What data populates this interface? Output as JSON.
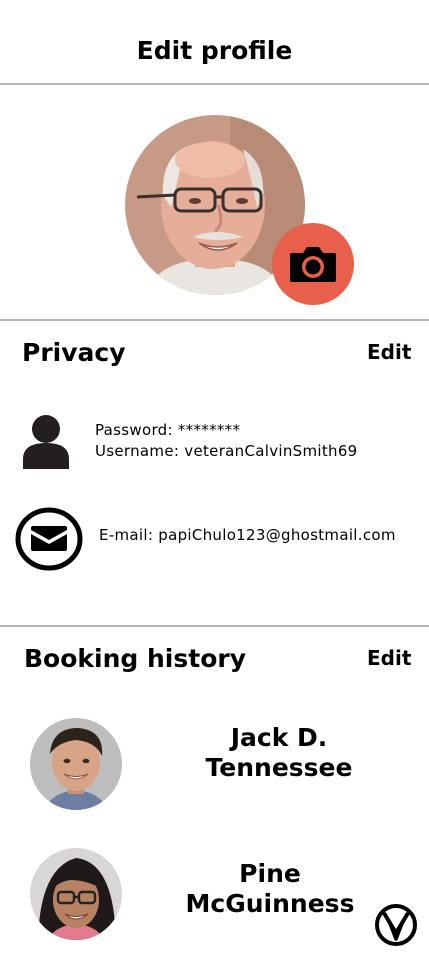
{
  "header": {
    "title": "Edit profile"
  },
  "profile": {
    "avatar_icon": "profile-photo",
    "camera_icon": "camera-icon",
    "accent_color": "#e8604c"
  },
  "privacy": {
    "title": "Privacy",
    "edit_label": "Edit",
    "password_line": "Password: ********",
    "username_line": "Username: veteranCalvinSmith69",
    "email_line": "E-mail: papiChulo123@ghostmail.com"
  },
  "booking_history": {
    "title": "Booking history",
    "edit_label": "Edit",
    "people": [
      {
        "name_line1": "Jack D.",
        "name_line2": "Tennessee"
      },
      {
        "name_line1": "Pine",
        "name_line2": "McGuinness"
      }
    ]
  },
  "brand": {
    "logo_icon": "brand-logo-icon"
  }
}
